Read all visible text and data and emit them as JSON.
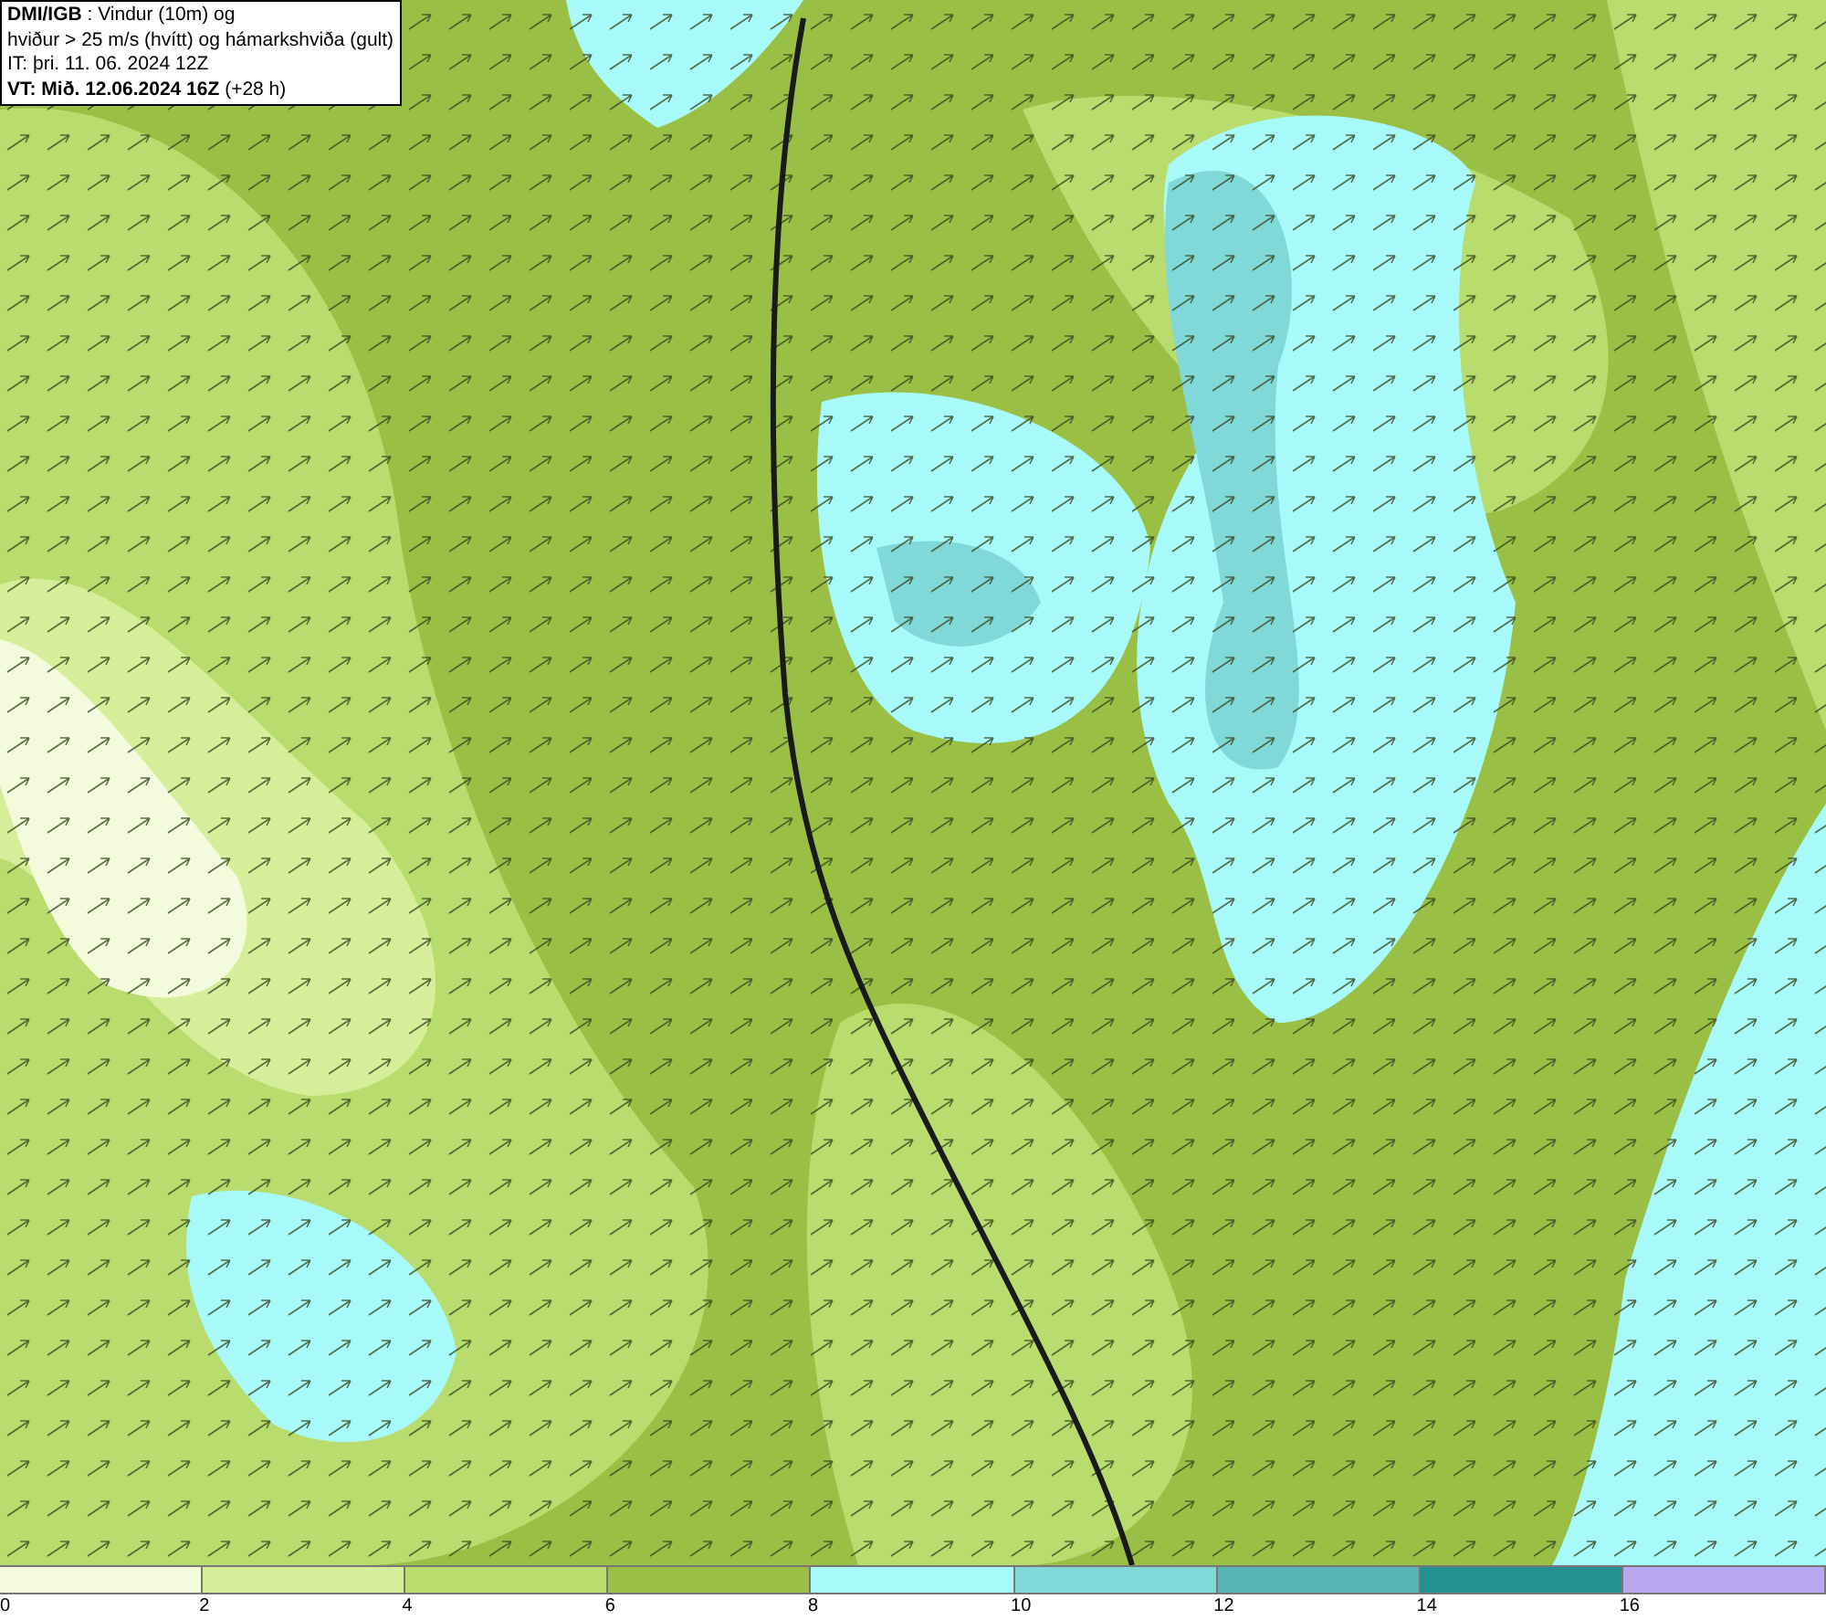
{
  "title_box": {
    "lines": [
      "**DMI/IGB** : Vindur (10m) og",
      "hviður > 25 m/s (hvítt) og hámarkshviða (gult)",
      "IT: þri. 11. 06. 2024 12Z",
      "**VT: Mið. 12.06.2024 16Z** (+28 h)"
    ]
  },
  "legend": {
    "segments": [
      {
        "color": "#f4fadc",
        "label": "0"
      },
      {
        "color": "#d6ee99",
        "label": "2"
      },
      {
        "color": "#b8dc6e",
        "label": "4"
      },
      {
        "color": "#99c045",
        "label": "6"
      },
      {
        "color": "#a8fafa",
        "label": "8"
      },
      {
        "color": "#80d8d8",
        "label": "10"
      },
      {
        "color": "#56b4b4",
        "label": "12"
      },
      {
        "color": "#259090",
        "label": "14"
      },
      {
        "color": "#b8a8f0",
        "label": "16"
      }
    ]
  }
}
